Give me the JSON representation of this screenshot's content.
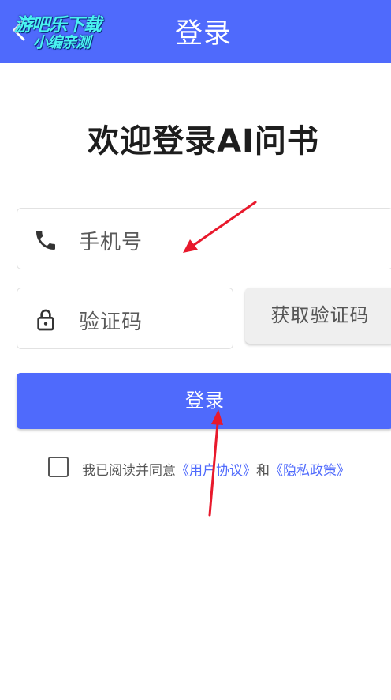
{
  "topbar": {
    "title": "登录",
    "watermark_line1": "游吧乐下载",
    "watermark_line2": "小编亲测"
  },
  "welcome": "欢迎登录AI问书",
  "phone_field": {
    "placeholder": "手机号",
    "icon": "phone-icon"
  },
  "code_field": {
    "placeholder": "验证码",
    "icon": "lock-icon"
  },
  "get_code_label": "获取验证码",
  "login_label": "登录",
  "agreement": {
    "prefix": "我已阅读并同意",
    "user_agreement": "《用户协议》",
    "and": "和",
    "privacy_policy": "《隐私政策》",
    "checked": false
  },
  "colors": {
    "brand": "#4f6afc",
    "annotation_arrow": "#e8192c"
  }
}
